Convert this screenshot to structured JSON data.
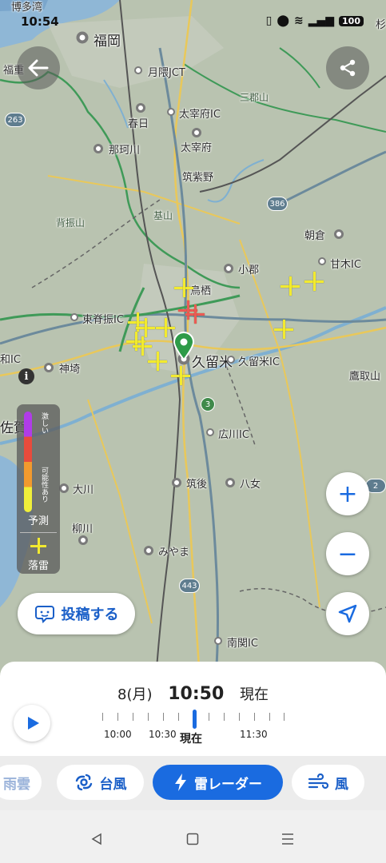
{
  "status_bar": {
    "time": "10:54",
    "battery": "100",
    "icons": [
      "vibrate-icon",
      "location-icon",
      "wifi-icon",
      "signal-icon"
    ]
  },
  "map": {
    "places": [
      {
        "name": "博多湾"
      },
      {
        "name": "福岡"
      },
      {
        "name": "福重"
      },
      {
        "name": "月隈JCT"
      },
      {
        "name": "太宰府IC"
      },
      {
        "name": "春日"
      },
      {
        "name": "那珂川"
      },
      {
        "name": "太宰府"
      },
      {
        "name": "筑紫野"
      },
      {
        "name": "三郡山"
      },
      {
        "name": "背振山"
      },
      {
        "name": "基山"
      },
      {
        "name": "朝倉"
      },
      {
        "name": "甘木IC"
      },
      {
        "name": "小郡"
      },
      {
        "name": "鳥栖"
      },
      {
        "name": "東脊振IC"
      },
      {
        "name": "久留米"
      },
      {
        "name": "久留米IC"
      },
      {
        "name": "和IC"
      },
      {
        "name": "神埼"
      },
      {
        "name": "鷹取山"
      },
      {
        "name": "佐賀"
      },
      {
        "name": "広川IC"
      },
      {
        "name": "大川"
      },
      {
        "name": "筑後"
      },
      {
        "name": "八女"
      },
      {
        "name": "柳川"
      },
      {
        "name": "みやま"
      },
      {
        "name": "南関IC"
      },
      {
        "name": "杉"
      }
    ],
    "routes": [
      "263",
      "386",
      "3",
      "443",
      "2"
    ]
  },
  "legend": {
    "intense_label": "激しい",
    "possible_label": "可能性あり",
    "forecast_label": "予測",
    "lightning_label": "落雷"
  },
  "buttons": {
    "back": "back-arrow-icon",
    "share": "share-icon",
    "zoom_in": "+",
    "zoom_out": "−",
    "locate": "navigation-icon",
    "post_label": "投稿する"
  },
  "timeline": {
    "date": "8(月)",
    "time": "10:50",
    "status": "現在",
    "labels": [
      "10:00",
      "10:30",
      "現在",
      "11:30"
    ]
  },
  "tabs": [
    {
      "label": "雨雲",
      "icon": ""
    },
    {
      "label": "台風",
      "icon": "typhoon-icon"
    },
    {
      "label": "雷レーダー",
      "icon": "lightning-icon",
      "active": true
    },
    {
      "label": "風",
      "icon": "wind-icon"
    }
  ],
  "colors": {
    "accent": "#1a6be0",
    "lightning": "#f2ea2f",
    "lightning_recent": "#ea5a55",
    "marker": "#2e9b48"
  }
}
